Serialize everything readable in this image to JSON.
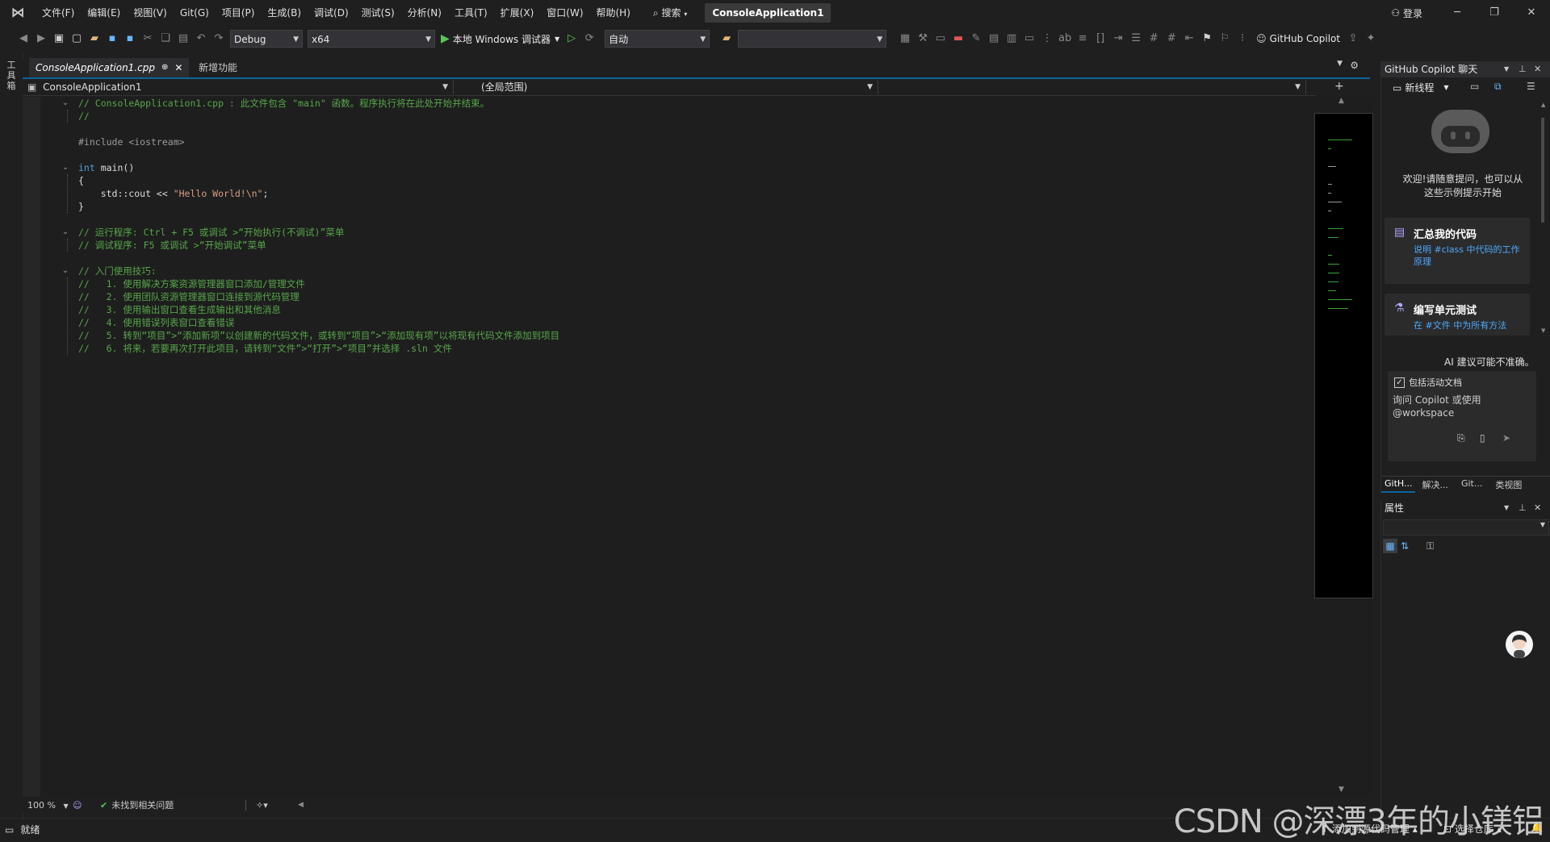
{
  "menu": {
    "items": [
      "文件(F)",
      "编辑(E)",
      "视图(V)",
      "Git(G)",
      "项目(P)",
      "生成(B)",
      "调试(D)",
      "测试(S)",
      "分析(N)",
      "工具(T)",
      "扩展(X)",
      "窗口(W)",
      "帮助(H)"
    ],
    "search_label": "搜索",
    "solution_title": "ConsoleApplication1",
    "login_label": "登录"
  },
  "toolbar": {
    "config": "Debug",
    "platform": "x64",
    "run_label": "本地 Windows 调试器",
    "auto_label": "自动",
    "copilot_label": "GitHub Copilot"
  },
  "leftstrip": {
    "label": "工具箱"
  },
  "tabs": {
    "active": "ConsoleApplication1.cpp",
    "inactive": "新增功能"
  },
  "navbar": {
    "project": "ConsoleApplication1",
    "scope": "(全局范围)"
  },
  "code": [
    {
      "t": "// ConsoleApplication1.cpp : 此文件包含 \"main\" 函数。程序执行将在此处开始并结束。",
      "c": "c-comment"
    },
    {
      "t": "//",
      "c": "c-comment"
    },
    {
      "t": "",
      "c": "c-plain"
    },
    {
      "t": "#include <iostream>",
      "c": "c-pre"
    },
    {
      "t": "",
      "c": "c-plain"
    },
    {
      "t": "int main()",
      "c": "c-plain"
    },
    {
      "t": "{",
      "c": "c-plain"
    },
    {
      "t": "    std::cout << \"Hello World!\\n\";",
      "c": "c-plain"
    },
    {
      "t": "}",
      "c": "c-plain"
    },
    {
      "t": "",
      "c": "c-plain"
    },
    {
      "t": "// 运行程序: Ctrl + F5 或调试 >“开始执行(不调试)”菜单",
      "c": "c-comment"
    },
    {
      "t": "// 调试程序: F5 或调试 >“开始调试”菜单",
      "c": "c-comment"
    },
    {
      "t": "",
      "c": "c-plain"
    },
    {
      "t": "// 入门使用技巧:",
      "c": "c-comment"
    },
    {
      "t": "//   1. 使用解决方案资源管理器窗口添加/管理文件",
      "c": "c-comment"
    },
    {
      "t": "//   2. 使用团队资源管理器窗口连接到源代码管理",
      "c": "c-comment"
    },
    {
      "t": "//   3. 使用输出窗口查看生成输出和其他消息",
      "c": "c-comment"
    },
    {
      "t": "//   4. 使用错误列表窗口查看错误",
      "c": "c-comment"
    },
    {
      "t": "//   5. 转到“项目”>“添加新项”以创建新的代码文件，或转到“项目”>“添加现有项”以将现有代码文件添加到项目",
      "c": "c-comment"
    },
    {
      "t": "//   6. 将来，若要再次打开此项目，请转到“文件”>“打开”>“项目”并选择 .sln 文件",
      "c": "c-comment"
    }
  ],
  "editor_status": {
    "zoom": "100 %",
    "issues": "未找到相关问题"
  },
  "copilot": {
    "title": "GitHub Copilot 聊天",
    "new_thread": "新线程",
    "welcome": "欢迎!请随意提问，也可以从这些示例提示开始",
    "card1_title": "汇总我的代码",
    "card1_sub": "说明 #class 中代码的工作原理",
    "card2_title": "编写单元测试",
    "card2_sub": "在 #文件 中为所有方法",
    "ai_note": "AI 建议可能不准确。",
    "include_doc": "包括活动文档",
    "input_placeholder": "询问 Copilot 或使用 @workspace",
    "bottom_tabs": [
      "GitH...",
      "解决...",
      "Git...",
      "类视图"
    ]
  },
  "properties": {
    "title": "属性"
  },
  "statusbar": {
    "ready": "就绪",
    "add_source": "添加到源代码管理",
    "select_repo": "选择仓库"
  },
  "watermark": "CSDN @深漂3年的小镁铝",
  "colors": {
    "accent": "#0e639c",
    "run_green": "#57c754",
    "comment_green": "#57a64a",
    "keyword_blue": "#569cd6",
    "link_blue": "#4daafc"
  }
}
